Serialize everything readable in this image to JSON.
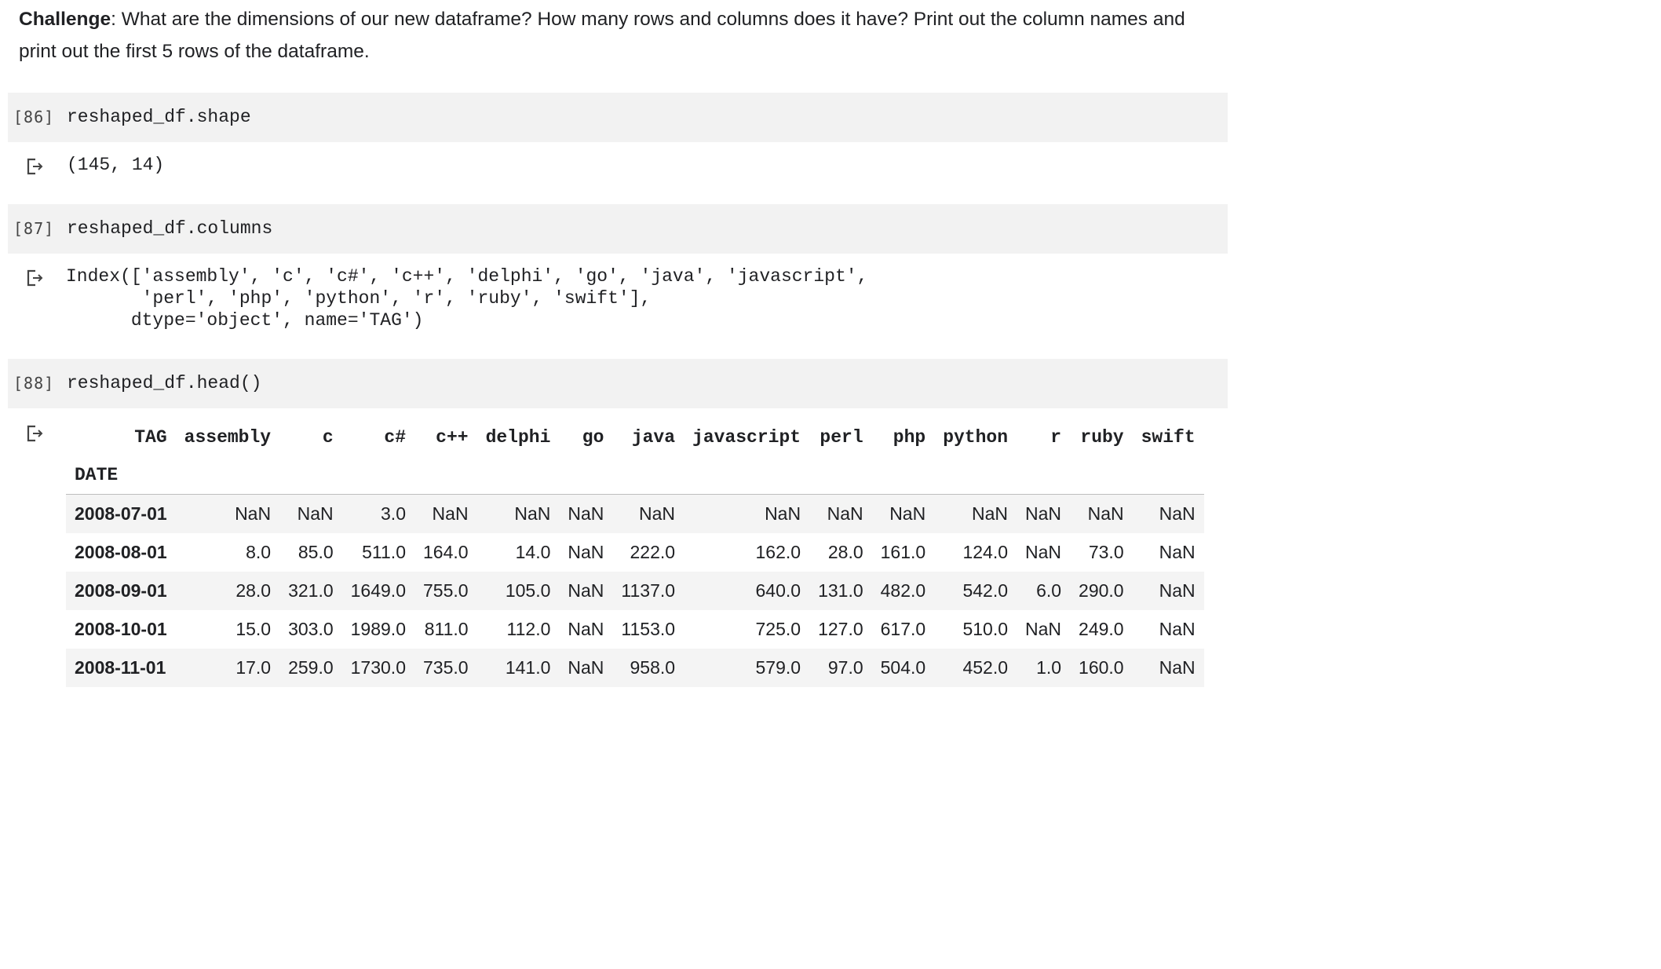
{
  "challenge": {
    "bold": "Challenge",
    "text": ": What are the dimensions of our new dataframe? How many rows and columns does it have? Print out the column names and print out the first 5 rows of the dataframe."
  },
  "cells": [
    {
      "count": "[86]",
      "code": "reshaped_df.shape",
      "output": "(145, 14)"
    },
    {
      "count": "[87]",
      "code": "reshaped_df.columns",
      "output": "Index(['assembly', 'c', 'c#', 'c++', 'delphi', 'go', 'java', 'javascript',\n       'perl', 'php', 'python', 'r', 'ruby', 'swift'],\n      dtype='object', name='TAG')"
    },
    {
      "count": "[88]",
      "code": "reshaped_df.head()"
    }
  ],
  "dataframe": {
    "columns_name": "TAG",
    "index_name": "DATE",
    "columns": [
      "assembly",
      "c",
      "c#",
      "c++",
      "delphi",
      "go",
      "java",
      "javascript",
      "perl",
      "php",
      "python",
      "r",
      "ruby",
      "swift"
    ],
    "rows": [
      {
        "index": "2008-07-01",
        "values": [
          "NaN",
          "NaN",
          "3.0",
          "NaN",
          "NaN",
          "NaN",
          "NaN",
          "NaN",
          "NaN",
          "NaN",
          "NaN",
          "NaN",
          "NaN",
          "NaN"
        ]
      },
      {
        "index": "2008-08-01",
        "values": [
          "8.0",
          "85.0",
          "511.0",
          "164.0",
          "14.0",
          "NaN",
          "222.0",
          "162.0",
          "28.0",
          "161.0",
          "124.0",
          "NaN",
          "73.0",
          "NaN"
        ]
      },
      {
        "index": "2008-09-01",
        "values": [
          "28.0",
          "321.0",
          "1649.0",
          "755.0",
          "105.0",
          "NaN",
          "1137.0",
          "640.0",
          "131.0",
          "482.0",
          "542.0",
          "6.0",
          "290.0",
          "NaN"
        ]
      },
      {
        "index": "2008-10-01",
        "values": [
          "15.0",
          "303.0",
          "1989.0",
          "811.0",
          "112.0",
          "NaN",
          "1153.0",
          "725.0",
          "127.0",
          "617.0",
          "510.0",
          "NaN",
          "249.0",
          "NaN"
        ]
      },
      {
        "index": "2008-11-01",
        "values": [
          "17.0",
          "259.0",
          "1730.0",
          "735.0",
          "141.0",
          "NaN",
          "958.0",
          "579.0",
          "97.0",
          "504.0",
          "452.0",
          "1.0",
          "160.0",
          "NaN"
        ]
      }
    ]
  }
}
